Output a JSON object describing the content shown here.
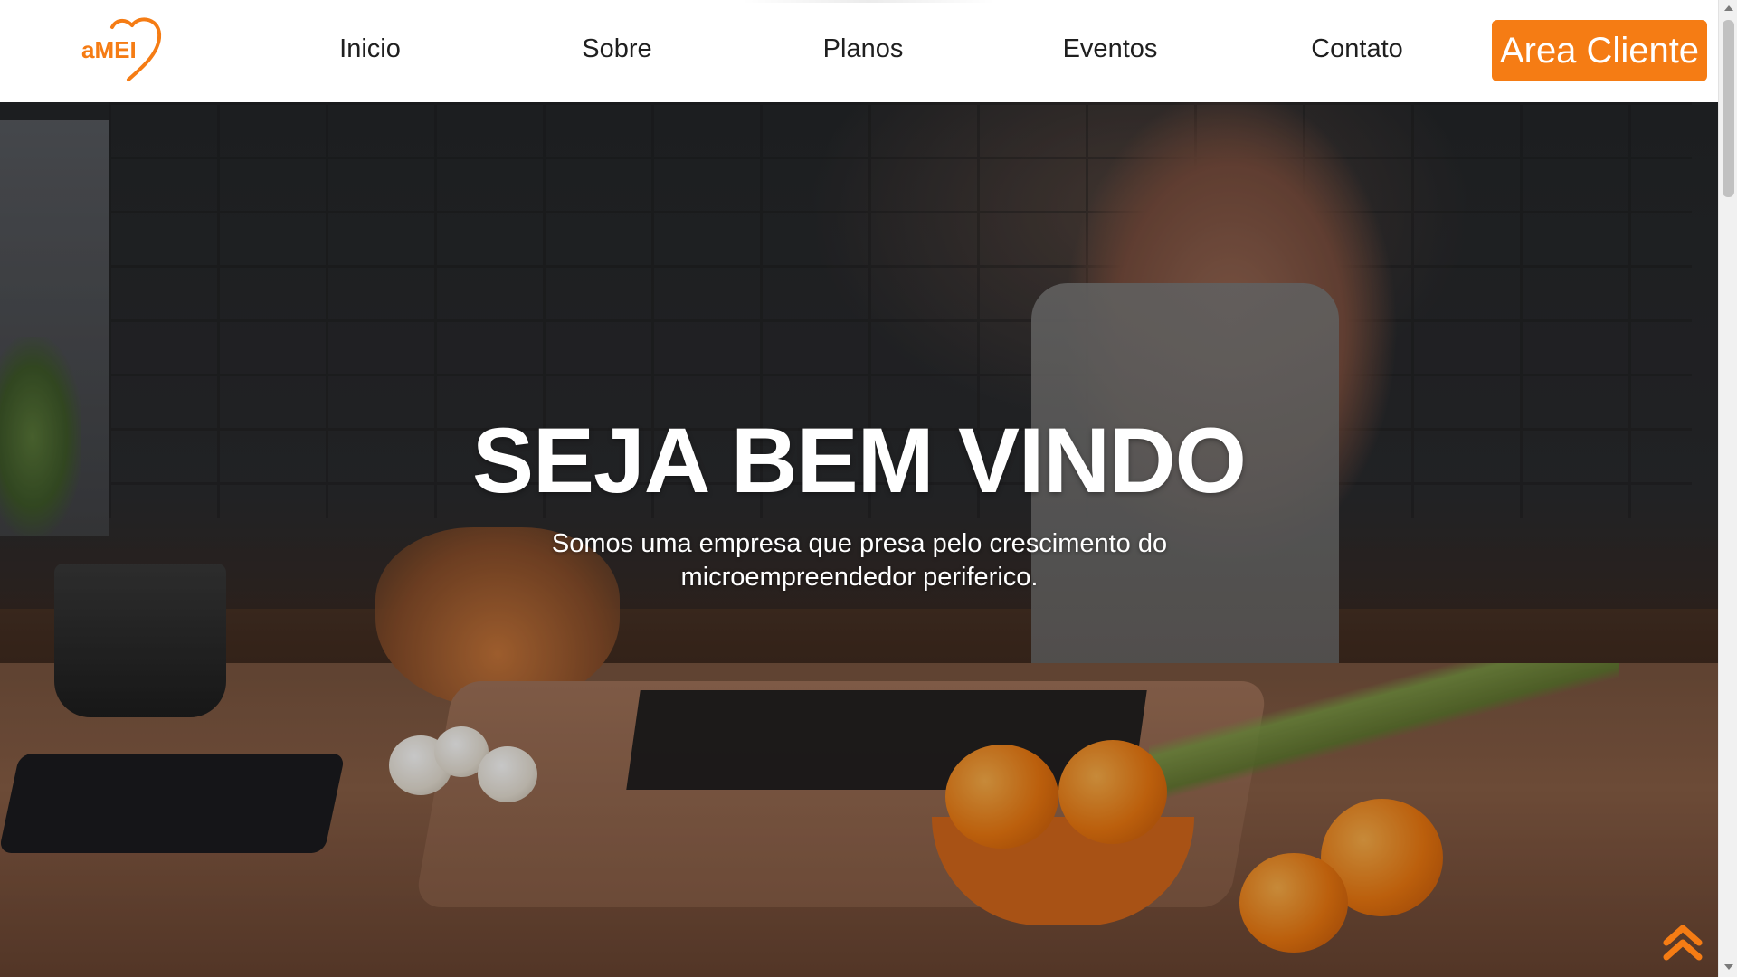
{
  "brand": {
    "logo_text": "aMEI",
    "accent_color": "#f57c14"
  },
  "nav": {
    "items": [
      {
        "label": "Inicio"
      },
      {
        "label": "Sobre"
      },
      {
        "label": "Planos"
      },
      {
        "label": "Eventos"
      },
      {
        "label": "Contato"
      }
    ],
    "cta_label": "Area Cliente"
  },
  "hero": {
    "title": "SEJA BEM VINDO",
    "subtitle_line1": "Somos uma empresa que presa pelo crescimento do",
    "subtitle_line2": "microempreendedor periferico."
  },
  "icons": {
    "back_to_top": "double-chevron-up-icon"
  }
}
